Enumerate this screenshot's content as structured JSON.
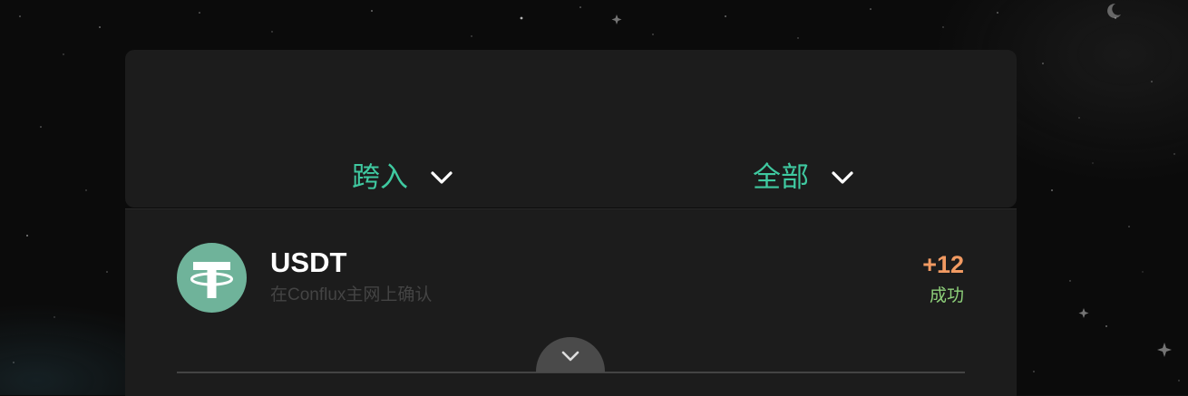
{
  "colors": {
    "accent": "#3fc9a0",
    "amount": "#f19a62",
    "success": "#8ed07a",
    "panel": "#1c1c1c",
    "token_icon": "#6fb39a"
  },
  "filters": {
    "direction": {
      "label": "跨入",
      "icon": "chevron-down-icon"
    },
    "status": {
      "label": "全部",
      "icon": "chevron-down-icon"
    }
  },
  "transactions": [
    {
      "token": "USDT",
      "description": "在Conflux主网上确认",
      "amount": "+12",
      "status": "成功",
      "icon": "tether-icon"
    }
  ],
  "expand": {
    "icon": "chevron-down-icon"
  }
}
